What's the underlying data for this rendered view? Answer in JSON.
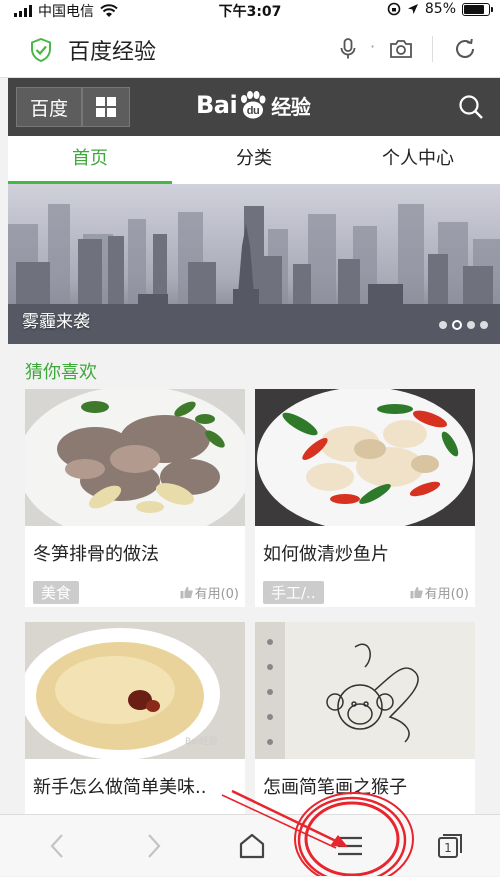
{
  "status": {
    "carrier": "中国电信",
    "time": "下午3:07",
    "battery": "85%",
    "battery_level": 0.85
  },
  "address_bar": {
    "title": "百度经验"
  },
  "nav": {
    "baidu_button": "百度",
    "logo_text_left": "Bai",
    "logo_text_paw": "du",
    "logo_text_right": "经验"
  },
  "tabs": [
    {
      "label": "首页",
      "active": true
    },
    {
      "label": "分类",
      "active": false
    },
    {
      "label": "个人中心",
      "active": false
    }
  ],
  "banner": {
    "caption": "雾霾来袭",
    "slide_count": 4,
    "active_slide": 2
  },
  "feed": {
    "section_title": "猜你喜欢",
    "cards": [
      {
        "title": "冬笋排骨的做法",
        "tag": "美食",
        "useful": "有用(0)"
      },
      {
        "title": "如何做清炒鱼片",
        "tag": "手工/..",
        "useful": "有用(0)"
      },
      {
        "title": "新手怎么做简单美味..",
        "tag": "",
        "useful": ""
      },
      {
        "title": "怎画简笔画之猴子",
        "tag": "",
        "useful": ""
      }
    ]
  },
  "colors": {
    "accent": "#47b843",
    "nav_bg": "#444444",
    "annotation_red": "#e8242c"
  }
}
